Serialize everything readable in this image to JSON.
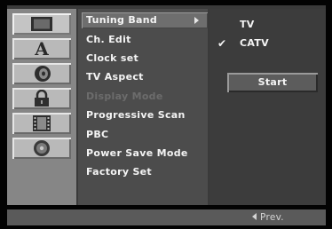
{
  "tabs": [
    {
      "icon": "tv-icon",
      "active": true
    },
    {
      "icon": "language-icon",
      "label": "A"
    },
    {
      "icon": "speaker-icon"
    },
    {
      "icon": "lock-icon"
    },
    {
      "icon": "film-icon"
    },
    {
      "icon": "disc-icon"
    }
  ],
  "menu": {
    "items": [
      {
        "label": "Tuning Band",
        "selected": true,
        "has_submenu": true
      },
      {
        "label": "Ch. Edit"
      },
      {
        "label": "Clock set"
      },
      {
        "label": "TV Aspect"
      },
      {
        "label": "Display Mode",
        "disabled": true
      },
      {
        "label": "Progressive Scan"
      },
      {
        "label": "PBC"
      },
      {
        "label": "Power Save Mode"
      },
      {
        "label": "Factory Set"
      }
    ]
  },
  "options": {
    "items": [
      {
        "label": "TV",
        "checked": false
      },
      {
        "label": "CATV",
        "checked": true
      }
    ],
    "check_mark": "✔",
    "start_label": "Start"
  },
  "footer": {
    "prev_label": "Prev."
  }
}
